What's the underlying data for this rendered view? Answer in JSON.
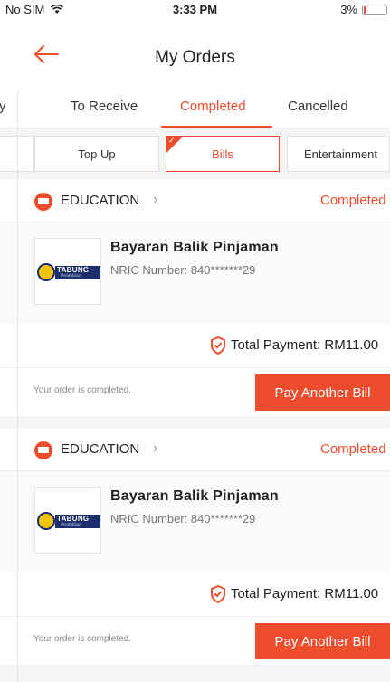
{
  "status_bar": {
    "carrier": "No SIM",
    "time": "3:33 PM",
    "battery": "3%"
  },
  "header": {
    "title": "My Orders"
  },
  "tabs": [
    {
      "label": "y"
    },
    {
      "label": "To Receive"
    },
    {
      "label": "Completed",
      "active": true
    },
    {
      "label": "Cancelled"
    }
  ],
  "categories": [
    {
      "label": ""
    },
    {
      "label": "Top Up"
    },
    {
      "label": "Bills",
      "active": true
    },
    {
      "label": "Entertainment"
    }
  ],
  "orders": [
    {
      "category": "EDUCATION",
      "status": "Completed",
      "logo_text": "TABUNG",
      "logo_subtext": "Pendidikan",
      "item_title": "Bayaran Balik Pinjaman",
      "item_detail": "NRIC Number: 840*******29",
      "total": "Total Payment: RM11.00",
      "message": "Your order is completed.",
      "action_label": "Pay Another Bill"
    },
    {
      "category": "EDUCATION",
      "status": "Completed",
      "logo_text": "TABUNG",
      "logo_subtext": "Pendidikan",
      "item_title": "Bayaran Balik Pinjaman",
      "item_detail": "NRIC Number: 840*******29",
      "total": "Total Payment: RM11.00",
      "message": "Your order is completed.",
      "action_label": "Pay Another Bill"
    }
  ],
  "colors": {
    "accent": "#ee4d2d",
    "background": "#f5f5f5"
  }
}
